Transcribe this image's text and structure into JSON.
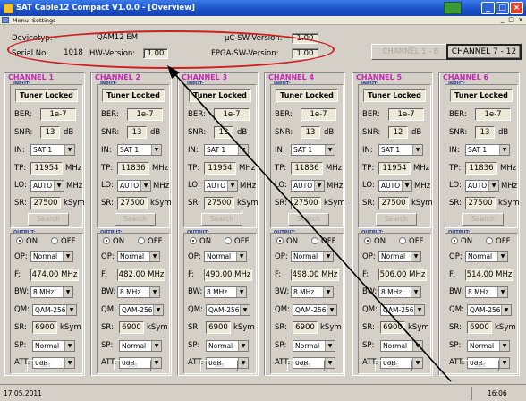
{
  "window": {
    "title": "SAT Cable12 Compact V1.0.0 - [Overview]",
    "menu": [
      "Menu",
      "Settings"
    ],
    "menu_right": [
      "_",
      "□",
      "x"
    ]
  },
  "device": {
    "devicetyp_label": "Devicetyp:",
    "devicetyp_value": "QAM12 EM",
    "serial_label": "Serial No:",
    "serial_value": "1018",
    "hw_label": "HW-Version:",
    "hw_value": "1.00",
    "uc_label": "µC-SW-Version:",
    "uc_value": "1.00",
    "fpga_label": "FPGA-SW-Version:",
    "fpga_value": "1.00",
    "highlight_color": "#d01d1d"
  },
  "channel_buttons": {
    "group1": "CHANNEL 1 - 6",
    "group2": "CHANNEL 7 - 12"
  },
  "labels": {
    "input": "INPUT:",
    "ber": "BER:",
    "snr": "SNR:",
    "in": "IN:",
    "tp": "TP:",
    "lo": "LO:",
    "sr": "SR:",
    "search": "Search",
    "output": "OUTPUT:",
    "on": "ON",
    "off": "OFF",
    "op": "OP:",
    "f": "F:",
    "bw": "BW:",
    "qm": "QM:",
    "sr_out": "SR:",
    "sp": "SP:",
    "att": "ATT:",
    "set": "Set",
    "unit_mhz": "MHz",
    "unit_ksym": "kSym",
    "unit_db": "dB"
  },
  "channels": [
    {
      "title": "CHANNEL 1",
      "status": "Tuner Locked",
      "ber": "1e-7",
      "snr": "13",
      "in": "SAT 1",
      "tp": "11954",
      "lo": "AUTO",
      "sr": "27500",
      "op": "Normal",
      "freq": "474,00 MHz",
      "bw": "8 MHz",
      "qm": "QAM-256",
      "sr_out": "6900",
      "sp": "Normal",
      "att": "0dB"
    },
    {
      "title": "CHANNEL 2",
      "status": "Tuner Locked",
      "ber": "1e-7",
      "snr": "13",
      "in": "SAT 1",
      "tp": "11836",
      "lo": "AUTO",
      "sr": "27500",
      "op": "Normal",
      "freq": "482,00 MHz",
      "bw": "8 MHz",
      "qm": "QAM-256",
      "sr_out": "6900",
      "sp": "Normal",
      "att": "0dB"
    },
    {
      "title": "CHANNEL 3",
      "status": "Tuner Locked",
      "ber": "1e-7",
      "snr": "13",
      "in": "SAT 1",
      "tp": "11954",
      "lo": "AUTO",
      "sr": "27500",
      "op": "Normal",
      "freq": "490,00 MHz",
      "bw": "8 MHz",
      "qm": "QAM-256",
      "sr_out": "6900",
      "sp": "Normal",
      "att": "0dB"
    },
    {
      "title": "CHANNEL 4",
      "status": "Tuner Locked",
      "ber": "1e-7",
      "snr": "13",
      "in": "SAT 1",
      "tp": "11836",
      "lo": "AUTO",
      "sr": "27500",
      "op": "Normal",
      "freq": "498,00 MHz",
      "bw": "8 MHz",
      "qm": "QAM-256",
      "sr_out": "6900",
      "sp": "Normal",
      "att": "0dB"
    },
    {
      "title": "CHANNEL 5",
      "status": "Tuner Locked",
      "ber": "1e-7",
      "snr": "12",
      "in": "SAT 1",
      "tp": "11954",
      "lo": "AUTO",
      "sr": "27500",
      "op": "Normal",
      "freq": "506,00 MHz",
      "bw": "8 MHz",
      "qm": "QAM-256",
      "sr_out": "6900",
      "sp": "Normal",
      "att": "0dB"
    },
    {
      "title": "CHANNEL 6",
      "status": "Tuner Locked",
      "ber": "1e-7",
      "snr": "13",
      "in": "SAT 1",
      "tp": "11836",
      "lo": "AUTO",
      "sr": "27500",
      "op": "Normal",
      "freq": "514,00 MHz",
      "bw": "8 MHz",
      "qm": "QAM-256",
      "sr_out": "6900",
      "sp": "Normal",
      "att": "0dB"
    }
  ],
  "status": {
    "date": "17.05.2011",
    "time": "16:06"
  },
  "colors": {
    "channel_title": "#c824b8",
    "section_label": "#1f3b9c",
    "titlebar": "#1a4fc8"
  }
}
